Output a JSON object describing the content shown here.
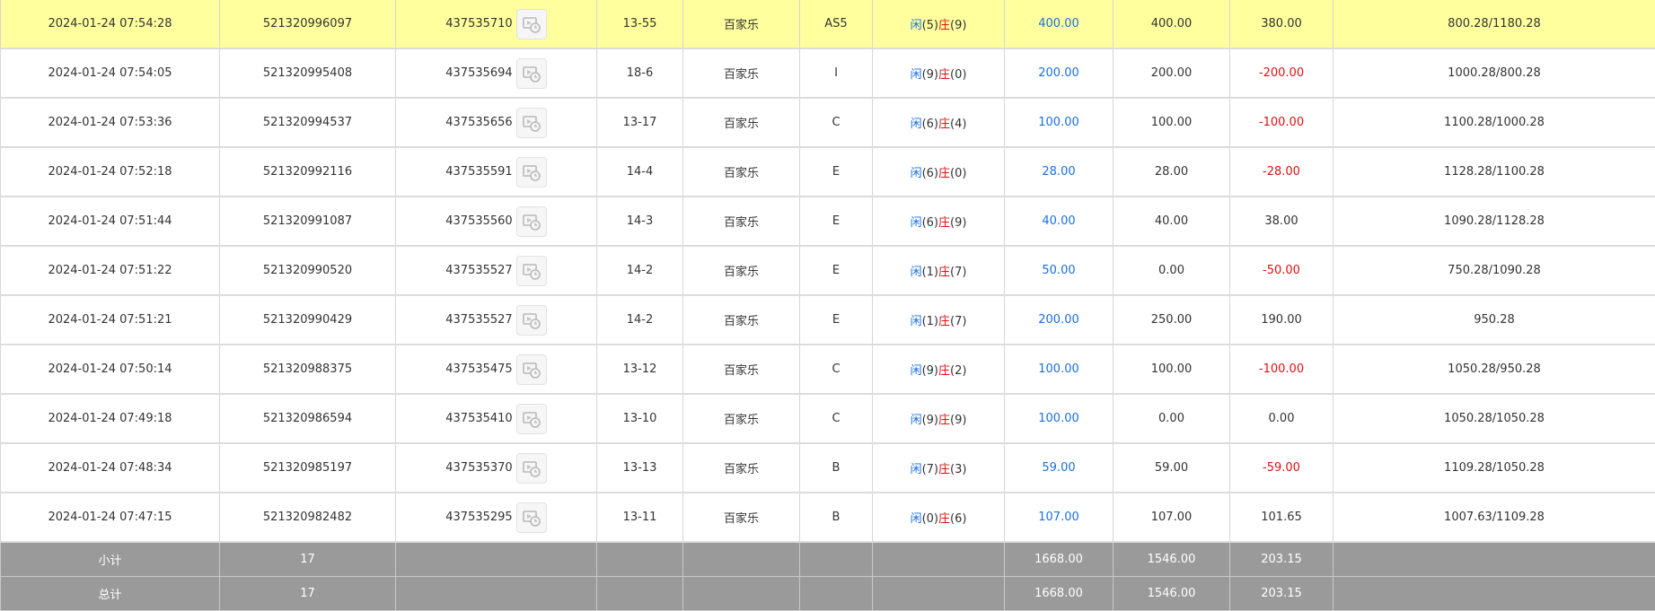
{
  "colors": {
    "highlight": "#ffff9e",
    "blue": "#1a6fe0",
    "red": "#e01010",
    "summary_bg": "#9a9a9a"
  },
  "icons": {
    "replay": "video-replay-icon"
  },
  "rows": [
    {
      "time": "2024-01-24 07:54:28",
      "bet_id": "521320996097",
      "round_id": "437535710",
      "table": "13-55",
      "game": "百家乐",
      "type": "AS5",
      "player_label": "闲",
      "player_points": "(5)",
      "banker_label": "庄",
      "banker_points": "(9)",
      "bet": "400.00",
      "valid": "400.00",
      "winloss": "380.00",
      "winloss_color": "normal",
      "balance": "800.28/1180.28",
      "highlight": true
    },
    {
      "time": "2024-01-24 07:54:05",
      "bet_id": "521320995408",
      "round_id": "437535694",
      "table": "18-6",
      "game": "百家乐",
      "type": "I",
      "player_label": "闲",
      "player_points": "(9)",
      "banker_label": "庄",
      "banker_points": "(0)",
      "bet": "200.00",
      "valid": "200.00",
      "winloss": "-200.00",
      "winloss_color": "red",
      "balance": "1000.28/800.28",
      "highlight": false
    },
    {
      "time": "2024-01-24 07:53:36",
      "bet_id": "521320994537",
      "round_id": "437535656",
      "table": "13-17",
      "game": "百家乐",
      "type": "C",
      "player_label": "闲",
      "player_points": "(6)",
      "banker_label": "庄",
      "banker_points": "(4)",
      "bet": "100.00",
      "valid": "100.00",
      "winloss": "-100.00",
      "winloss_color": "red",
      "balance": "1100.28/1000.28",
      "highlight": false
    },
    {
      "time": "2024-01-24 07:52:18",
      "bet_id": "521320992116",
      "round_id": "437535591",
      "table": "14-4",
      "game": "百家乐",
      "type": "E",
      "player_label": "闲",
      "player_points": "(6)",
      "banker_label": "庄",
      "banker_points": "(0)",
      "bet": "28.00",
      "valid": "28.00",
      "winloss": "-28.00",
      "winloss_color": "red",
      "balance": "1128.28/1100.28",
      "highlight": false
    },
    {
      "time": "2024-01-24 07:51:44",
      "bet_id": "521320991087",
      "round_id": "437535560",
      "table": "14-3",
      "game": "百家乐",
      "type": "E",
      "player_label": "闲",
      "player_points": "(6)",
      "banker_label": "庄",
      "banker_points": "(9)",
      "bet": "40.00",
      "valid": "40.00",
      "winloss": "38.00",
      "winloss_color": "normal",
      "balance": "1090.28/1128.28",
      "highlight": false
    },
    {
      "time": "2024-01-24 07:51:22",
      "bet_id": "521320990520",
      "round_id": "437535527",
      "table": "14-2",
      "game": "百家乐",
      "type": "E",
      "player_label": "闲",
      "player_points": "(1)",
      "banker_label": "庄",
      "banker_points": "(7)",
      "bet": "50.00",
      "valid": "0.00",
      "winloss": "-50.00",
      "winloss_color": "red",
      "balance": "750.28/1090.28",
      "highlight": false
    },
    {
      "time": "2024-01-24 07:51:21",
      "bet_id": "521320990429",
      "round_id": "437535527",
      "table": "14-2",
      "game": "百家乐",
      "type": "E",
      "player_label": "闲",
      "player_points": "(1)",
      "banker_label": "庄",
      "banker_points": "(7)",
      "bet": "200.00",
      "valid": "250.00",
      "winloss": "190.00",
      "winloss_color": "normal",
      "balance": "950.28",
      "highlight": false
    },
    {
      "time": "2024-01-24 07:50:14",
      "bet_id": "521320988375",
      "round_id": "437535475",
      "table": "13-12",
      "game": "百家乐",
      "type": "C",
      "player_label": "闲",
      "player_points": "(9)",
      "banker_label": "庄",
      "banker_points": "(2)",
      "bet": "100.00",
      "valid": "100.00",
      "winloss": "-100.00",
      "winloss_color": "red",
      "balance": "1050.28/950.28",
      "highlight": false
    },
    {
      "time": "2024-01-24 07:49:18",
      "bet_id": "521320986594",
      "round_id": "437535410",
      "table": "13-10",
      "game": "百家乐",
      "type": "C",
      "player_label": "闲",
      "player_points": "(9)",
      "banker_label": "庄",
      "banker_points": "(9)",
      "bet": "100.00",
      "valid": "0.00",
      "winloss": "0.00",
      "winloss_color": "normal",
      "balance": "1050.28/1050.28",
      "highlight": false
    },
    {
      "time": "2024-01-24 07:48:34",
      "bet_id": "521320985197",
      "round_id": "437535370",
      "table": "13-13",
      "game": "百家乐",
      "type": "B",
      "player_label": "闲",
      "player_points": "(7)",
      "banker_label": "庄",
      "banker_points": "(3)",
      "bet": "59.00",
      "valid": "59.00",
      "winloss": "-59.00",
      "winloss_color": "red",
      "balance": "1109.28/1050.28",
      "highlight": false
    },
    {
      "time": "2024-01-24 07:47:15",
      "bet_id": "521320982482",
      "round_id": "437535295",
      "table": "13-11",
      "game": "百家乐",
      "type": "B",
      "player_label": "闲",
      "player_points": "(0)",
      "banker_label": "庄",
      "banker_points": "(6)",
      "bet": "107.00",
      "valid": "107.00",
      "winloss": "101.65",
      "winloss_color": "normal",
      "balance": "1007.63/1109.28",
      "highlight": false
    }
  ],
  "subtotal": {
    "label": "小计",
    "count": "17",
    "bet": "1668.00",
    "valid": "1546.00",
    "winloss": "203.15"
  },
  "total": {
    "label": "总计",
    "count": "17",
    "bet": "1668.00",
    "valid": "1546.00",
    "winloss": "203.15"
  }
}
